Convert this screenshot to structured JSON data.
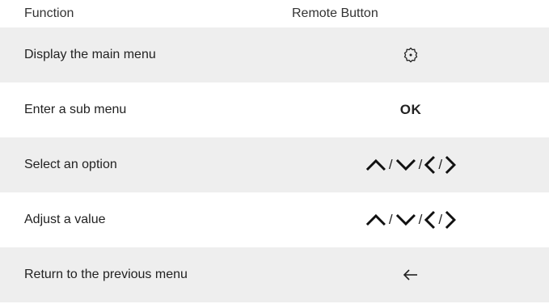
{
  "header": {
    "function_label": "Function",
    "button_label": "Remote Button"
  },
  "rows": [
    {
      "function": "Display the main menu",
      "button": {
        "type": "icon",
        "icon": "gear-icon"
      }
    },
    {
      "function": "Enter a sub menu",
      "button": {
        "type": "text",
        "text": "OK"
      }
    },
    {
      "function": "Select an option",
      "button": {
        "type": "arrows",
        "icons": [
          "up-arrow-icon",
          "down-arrow-icon",
          "left-arrow-icon",
          "right-arrow-icon"
        ],
        "separator": "/"
      }
    },
    {
      "function": "Adjust a value",
      "button": {
        "type": "arrows",
        "icons": [
          "up-arrow-icon",
          "down-arrow-icon",
          "left-arrow-icon",
          "right-arrow-icon"
        ],
        "separator": "/"
      }
    },
    {
      "function": "Return to the previous menu",
      "button": {
        "type": "icon",
        "icon": "back-arrow-icon"
      }
    }
  ],
  "colors": {
    "row_shade": "#eeeeee",
    "text": "#222222"
  }
}
